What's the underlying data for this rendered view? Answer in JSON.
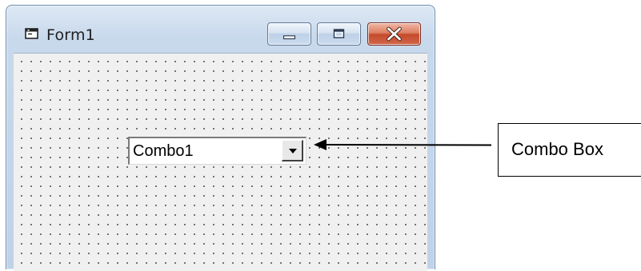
{
  "window": {
    "title": "Form1",
    "icon": "form-window-icon",
    "caption_buttons": {
      "minimize": "minimize-icon",
      "maximize": "maximize-icon",
      "close": "close-icon"
    },
    "close_button_color": "#c9502f"
  },
  "form": {
    "surface_color": "#f0f0f0",
    "combo_box": {
      "text": "Combo1",
      "dropdown_icon": "chevron-down-icon"
    }
  },
  "annotation": {
    "label": "Combo Box",
    "pointer_icon": "arrow-left-icon"
  }
}
